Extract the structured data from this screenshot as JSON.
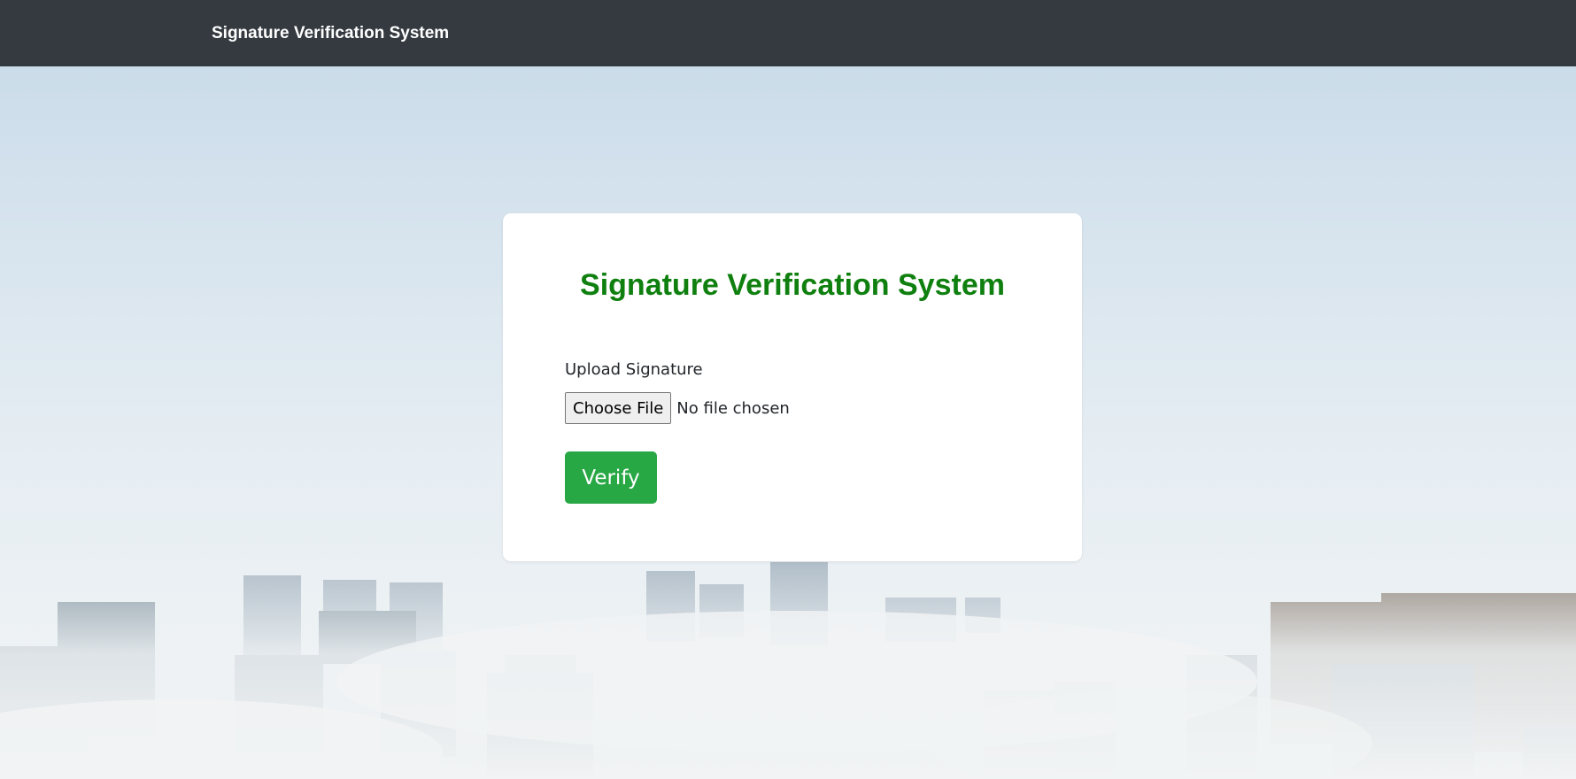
{
  "navbar": {
    "brand": "Signature Verification System"
  },
  "card": {
    "title": "Signature Verification System",
    "upload_label": "Upload Signature",
    "file_button_label": "Choose File",
    "file_status": "No file chosen",
    "verify_label": "Verify"
  },
  "colors": {
    "navbar_bg": "#343a40",
    "title_green": "#0f800f",
    "verify_green": "#28a745"
  }
}
